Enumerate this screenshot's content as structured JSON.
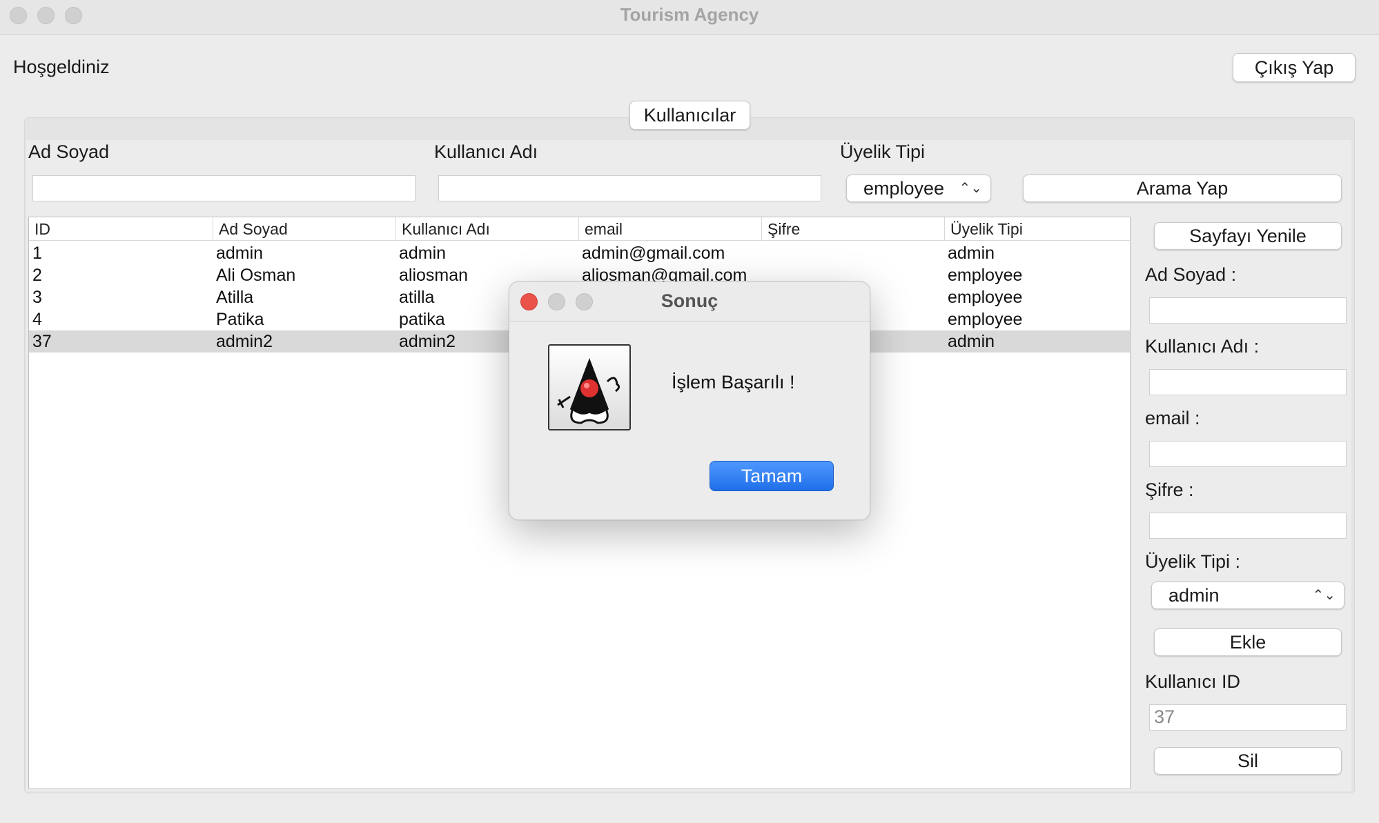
{
  "window": {
    "title": "Tourism Agency"
  },
  "header": {
    "welcome": "Hoşgeldiniz",
    "logout_label": "Çıkış Yap",
    "tab_label": "Kullanıcılar"
  },
  "search": {
    "name_label": "Ad Soyad",
    "username_label": "Kullanıcı Adı",
    "type_label": "Üyelik Tipi",
    "name_value": "",
    "username_value": "",
    "type_selected": "employee",
    "search_button": "Arama Yap"
  },
  "table": {
    "columns": [
      "ID",
      "Ad Soyad",
      "Kullanıcı Adı",
      "email",
      "Şifre",
      "Üyelik Tipi"
    ],
    "rows": [
      [
        "1",
        "admin",
        "admin",
        "admin@gmail.com",
        "",
        "admin"
      ],
      [
        "2",
        "Ali Osman",
        "aliosman",
        "aliosman@gmail.com",
        "",
        "employee"
      ],
      [
        "3",
        "Atilla",
        "atilla",
        "",
        "",
        "employee"
      ],
      [
        "4",
        "Patika",
        "patika",
        "",
        "",
        "employee"
      ],
      [
        "37",
        "admin2",
        "admin2",
        "",
        "",
        "admin"
      ]
    ],
    "selected_row": 4
  },
  "form": {
    "refresh_button": "Sayfayı Yenile",
    "name_label": "Ad Soyad :",
    "username_label": "Kullanıcı Adı :",
    "email_label": "email :",
    "password_label": "Şifre :",
    "type_label": "Üyelik Tipi :",
    "type_selected": "admin",
    "add_button": "Ekle",
    "user_id_label": "Kullanıcı ID",
    "user_id_value": "37",
    "delete_button": "Sil"
  },
  "dialog": {
    "title": "Sonuç",
    "message": "İşlem Başarılı !",
    "ok_button": "Tamam",
    "icon": "java-duke-icon",
    "close_color": "#e9534a",
    "ok_color": "#2f7df6"
  }
}
